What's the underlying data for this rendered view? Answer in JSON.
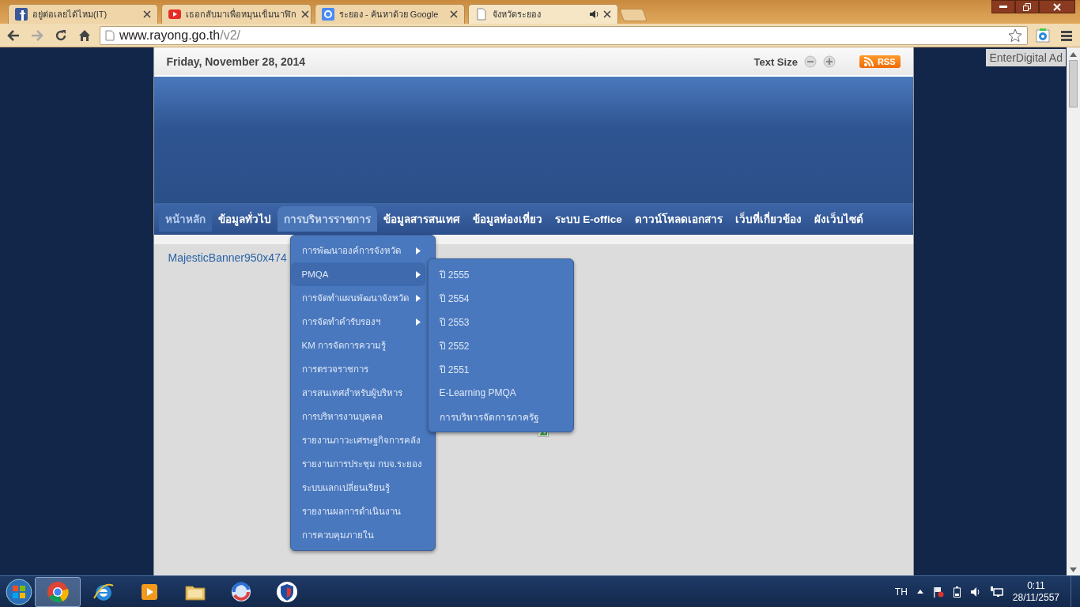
{
  "browser": {
    "tabs": [
      {
        "title": "อยู่ต่อเลยได้ไหม(IT)",
        "kind": "facebook",
        "selected": false,
        "audio": false
      },
      {
        "title": "เธอกลับมาเพื่อหมุนเข็มนาฬิก",
        "kind": "youtube",
        "selected": false,
        "audio": false
      },
      {
        "title": "ระยอง - ค้นหาด้วย Google",
        "kind": "google",
        "selected": false,
        "audio": false
      },
      {
        "title": "จังหวัดระยอง",
        "kind": "page",
        "selected": true,
        "audio": true
      }
    ],
    "address": {
      "host": "www.rayong.go.th",
      "path": "/v2/"
    }
  },
  "page": {
    "date": "Friday, November 28, 2014",
    "text_size_label": "Text Size",
    "rss_label": "RSS",
    "ad_label": "EnterDigital Ad",
    "nav": [
      {
        "label": "หน้าหลัก",
        "selected": true,
        "expanded": false
      },
      {
        "label": "ข้อมูลทั่วไป",
        "selected": false,
        "expanded": false
      },
      {
        "label": "การบริหารราชการ",
        "selected": false,
        "expanded": true
      },
      {
        "label": "ข้อมูลสารสนเทศ",
        "selected": false,
        "expanded": false
      },
      {
        "label": "ข้อมูลท่องเที่ยว",
        "selected": false,
        "expanded": false
      },
      {
        "label": "ระบบ E-office",
        "selected": false,
        "expanded": false
      },
      {
        "label": "ดาวน์โหลดเอกสาร",
        "selected": false,
        "expanded": false
      },
      {
        "label": "เว็บที่เกี่ยวข้อง",
        "selected": false,
        "expanded": false
      },
      {
        "label": "ผังเว็บไซต์",
        "selected": false,
        "expanded": false
      }
    ],
    "dropdown": [
      {
        "label": "การพัฒนาองค์การจังหวัด",
        "has_submenu": true,
        "selected": false
      },
      {
        "label": "PMQA",
        "has_submenu": true,
        "selected": true
      },
      {
        "label": "การจัดทำแผนพัฒนาจังหวัด",
        "has_submenu": true,
        "selected": false
      },
      {
        "label": "การจัดทำคำรับรองฯ",
        "has_submenu": true,
        "selected": false
      },
      {
        "label": "KM การจัดการความรู้",
        "has_submenu": false,
        "selected": false
      },
      {
        "label": "การตรวจราชการ",
        "has_submenu": false,
        "selected": false
      },
      {
        "label": "สารสนเทศสำหรับผู้บริหาร",
        "has_submenu": false,
        "selected": false
      },
      {
        "label": "การบริหารงานบุคคล",
        "has_submenu": false,
        "selected": false
      },
      {
        "label": "รายงานภาวะเศรษฐกิจการคลัง",
        "has_submenu": false,
        "selected": false
      },
      {
        "label": "รายงานการประชุม กบจ.ระยอง",
        "has_submenu": false,
        "selected": false
      },
      {
        "label": "ระบบแลกเปลี่ยนเรียนรู้",
        "has_submenu": false,
        "selected": false
      },
      {
        "label": "รายงานผลการดำเนินงาน",
        "has_submenu": false,
        "selected": false
      },
      {
        "label": "การควบคุมภายใน",
        "has_submenu": false,
        "selected": false
      }
    ],
    "submenu": [
      "ปี 2555",
      "ปี 2554",
      "ปี 2553",
      "ปี 2552",
      "ปี 2551",
      "E-Learning PMQA",
      "การบริหารจัดการภาครัฐ"
    ],
    "banner_link": "MajesticBanner950x474"
  },
  "taskbar": {
    "apps": [
      {
        "kind": "chrome",
        "selected": true
      },
      {
        "kind": "ie",
        "selected": false
      },
      {
        "kind": "media",
        "selected": false
      },
      {
        "kind": "folder",
        "selected": false
      },
      {
        "kind": "swirl",
        "selected": false
      },
      {
        "kind": "shield",
        "selected": false
      }
    ],
    "language": "TH",
    "time": "0:11",
    "date": "28/11/2557"
  }
}
